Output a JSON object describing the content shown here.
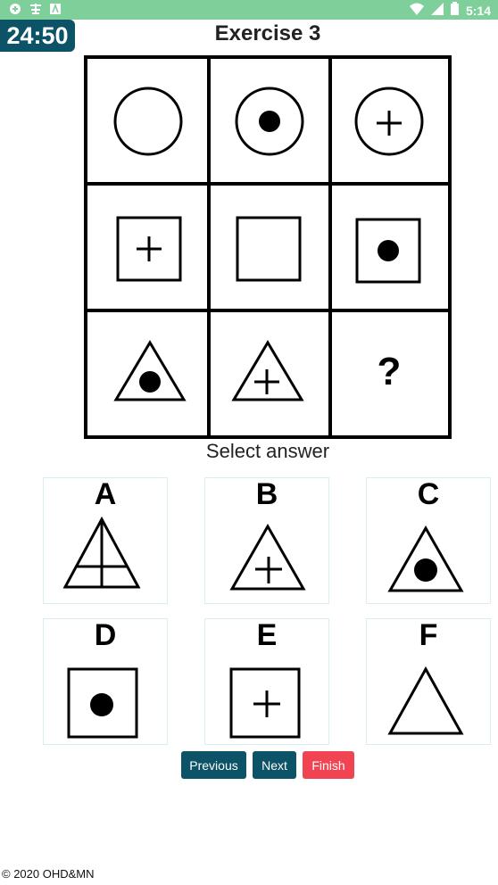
{
  "status_bar": {
    "time": "5:14",
    "left_icons": [
      "notification-icon",
      "app-icon",
      "a-icon"
    ],
    "right_icons": [
      "wifi-icon",
      "signal-icon",
      "battery-icon"
    ]
  },
  "timer": "24:50",
  "title": "Exercise 3",
  "question_grid": [
    [
      "circle-empty",
      "circle-dot",
      "circle-plus"
    ],
    [
      "square-plus",
      "square-empty",
      "square-dot"
    ],
    [
      "triangle-dot",
      "triangle-plus",
      "question-mark"
    ]
  ],
  "question_mark": "?",
  "select_label": "Select answer",
  "options": [
    {
      "letter": "A",
      "shape": "triangle-cross-lines"
    },
    {
      "letter": "B",
      "shape": "triangle-plus"
    },
    {
      "letter": "C",
      "shape": "triangle-dot"
    },
    {
      "letter": "D",
      "shape": "square-dot"
    },
    {
      "letter": "E",
      "shape": "square-plus"
    },
    {
      "letter": "F",
      "shape": "triangle-empty"
    }
  ],
  "buttons": {
    "previous": "Previous",
    "next": "Next",
    "finish": "Finish"
  },
  "colors": {
    "status_bar": "#7fcf9b",
    "primary": "#0c5367",
    "finish": "#f04452"
  },
  "footer": "© 2020 OHD&MN"
}
